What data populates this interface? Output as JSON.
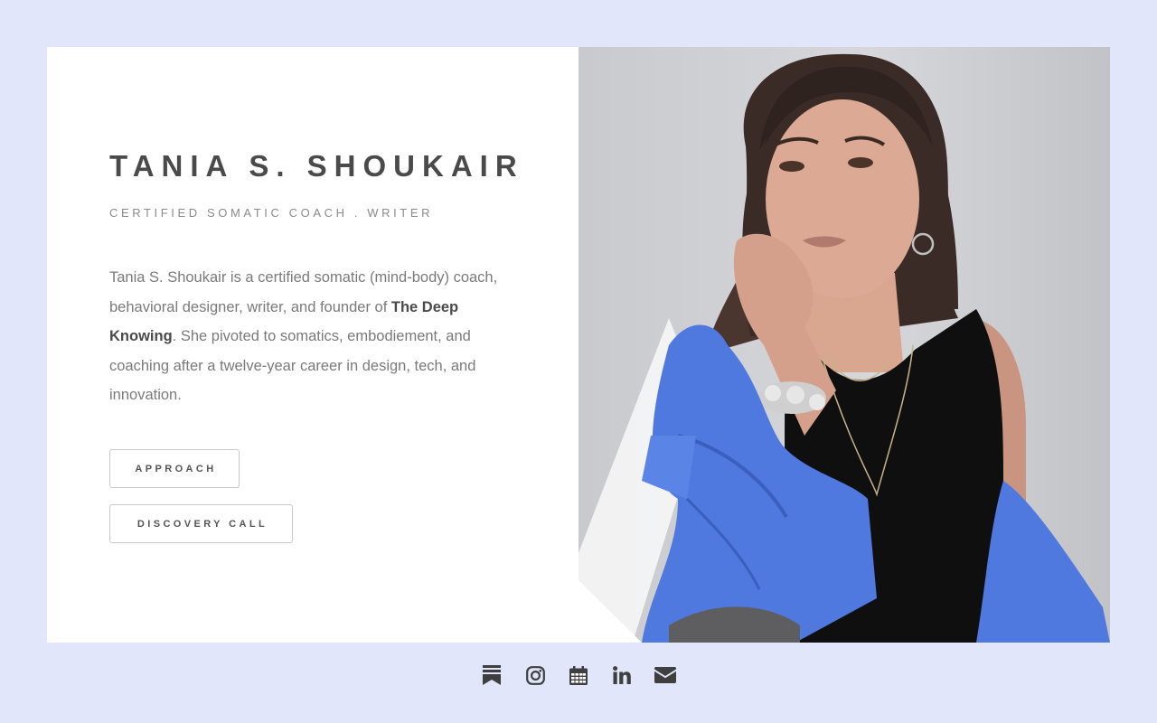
{
  "profile": {
    "name": "TANIA S. SHOUKAIR",
    "subtitle": "CERTIFIED SOMATIC COACH . WRITER",
    "bio_part1": "Tania S. Shoukair is a certified somatic (mind-body) coach, behavioral designer, writer, and founder of ",
    "bio_bold": "The Deep Knowing",
    "bio_part2": ". She pivoted to somatics, embodiement, and coaching after a twelve-year career in design, tech, and innovation."
  },
  "buttons": {
    "approach": "APPROACH",
    "discovery": "DISCOVERY CALL"
  },
  "footer": {
    "icons": [
      "substack-icon",
      "instagram-icon",
      "calendar-icon",
      "linkedin-icon",
      "email-icon"
    ]
  },
  "colors": {
    "page_background": "#e1e6fb",
    "card_background": "#ffffff",
    "heading": "#4a4a4a",
    "body_text": "#7a7a7a",
    "icon": "#3f3f3f",
    "shirt_blue": "#4f79de"
  }
}
